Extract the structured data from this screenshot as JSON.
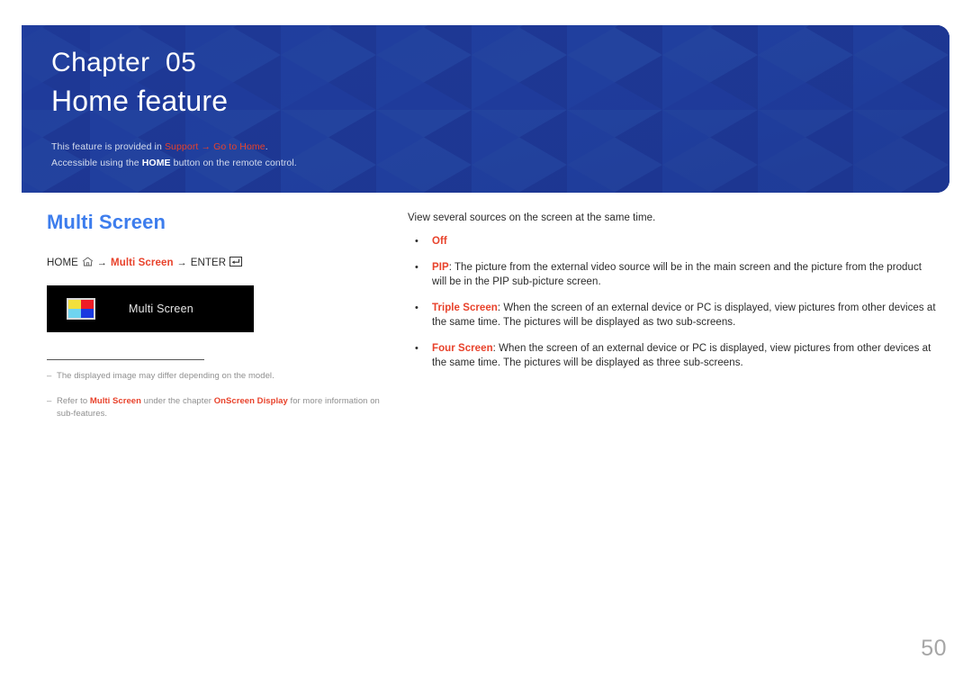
{
  "banner": {
    "chapter_label": "Chapter  05",
    "chapter_title": "Home feature",
    "note1_prefix": "This feature is provided in ",
    "note1_link1": "Support",
    "note1_arrow": " → ",
    "note1_link2": "Go to Home",
    "note1_suffix": ".",
    "note2_prefix": "Accessible using the ",
    "note2_bold": "HOME",
    "note2_suffix": " button on the remote control.",
    "bg_color": "#1f3b9b",
    "accent_color": "#e8422b"
  },
  "left": {
    "section_title": "Multi Screen",
    "path": {
      "home_label": "HOME",
      "home_icon": "home-icon",
      "arrow1": "→",
      "target_label": "Multi Screen",
      "arrow2": "→",
      "enter_label": "ENTER",
      "enter_icon": "enter-key-icon"
    },
    "menu_box": {
      "icon_name": "multi-screen-quad-icon",
      "icon_colors": {
        "top_left": "#f2e03c",
        "top_right": "#ee1c25",
        "bottom_left": "#6fd4f0",
        "bottom_right": "#1a3ae0",
        "border": "#d9d9d9"
      },
      "label": "Multi Screen",
      "background": "#000000"
    },
    "footnotes": [
      {
        "dash": "–",
        "parts": [
          {
            "text": "The displayed image may differ depending on the model.",
            "style": "normal"
          }
        ]
      },
      {
        "dash": "–",
        "parts": [
          {
            "text": "Refer to ",
            "style": "normal"
          },
          {
            "text": "Multi Screen",
            "style": "red"
          },
          {
            "text": " under the chapter ",
            "style": "normal"
          },
          {
            "text": "OnScreen Display",
            "style": "red"
          },
          {
            "text": " for more information on sub-features.",
            "style": "normal"
          }
        ]
      }
    ]
  },
  "right": {
    "intro": "View several sources on the screen at the same time.",
    "bullets": [
      {
        "dot": "•",
        "parts": [
          {
            "text": "Off",
            "style": "red"
          }
        ]
      },
      {
        "dot": "•",
        "parts": [
          {
            "text": "PIP",
            "style": "red"
          },
          {
            "text": ": The picture from the external video source will be in the main screen and the picture from the product will be in the PIP sub-picture screen.",
            "style": "normal"
          }
        ]
      },
      {
        "dot": "•",
        "parts": [
          {
            "text": "Triple Screen",
            "style": "red"
          },
          {
            "text": ": When the screen of an external device or PC is displayed, view pictures from other devices at the same time. The pictures will be displayed as two sub-screens.",
            "style": "normal"
          }
        ]
      },
      {
        "dot": "•",
        "parts": [
          {
            "text": "Four Screen",
            "style": "red"
          },
          {
            "text": ": When the screen of an external device or PC is displayed, view pictures from other devices at the same time. The pictures will be displayed as three sub-screens.",
            "style": "normal"
          }
        ]
      }
    ]
  },
  "page_number": "50"
}
